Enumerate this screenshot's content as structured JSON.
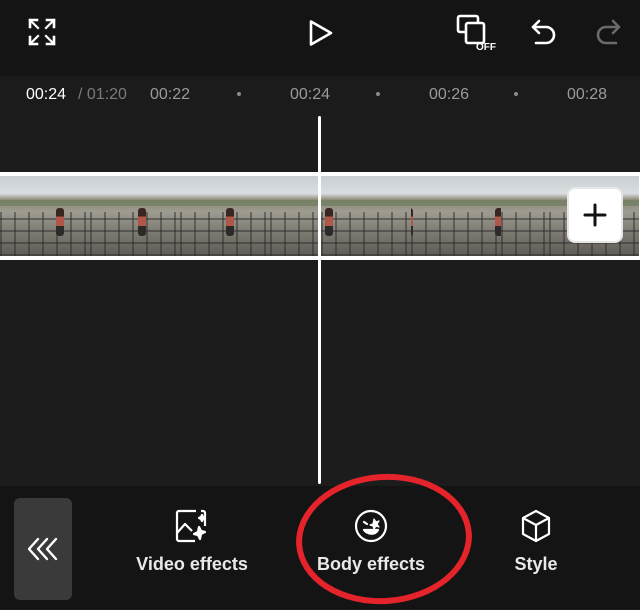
{
  "header": {
    "fullscreen_icon": "fullscreen-icon",
    "play_icon": "play-icon",
    "keyframe_off_icon": "keyframe-off-icon",
    "keyframe_off_badge": "OFF",
    "undo_icon": "undo-icon",
    "redo_icon": "redo-icon"
  },
  "timeline": {
    "current_time": "00:24",
    "total_time": "/ 01:20",
    "ticks": [
      "00:22",
      "00:24",
      "00:26",
      "00:28"
    ]
  },
  "clip": {
    "add_icon": "plus-icon"
  },
  "toolbar": {
    "collapse_icon": "double-chevron-left-icon",
    "items": [
      {
        "label": "Video effects",
        "icon": "video-effects-icon"
      },
      {
        "label": "Body effects",
        "icon": "body-effects-icon"
      },
      {
        "label": "Style",
        "icon": "cube-icon"
      }
    ]
  },
  "colors": {
    "background": "#1c1c1c",
    "toolbar": "#141414",
    "highlight": "#e4232b",
    "text": "#e9e9e9"
  }
}
